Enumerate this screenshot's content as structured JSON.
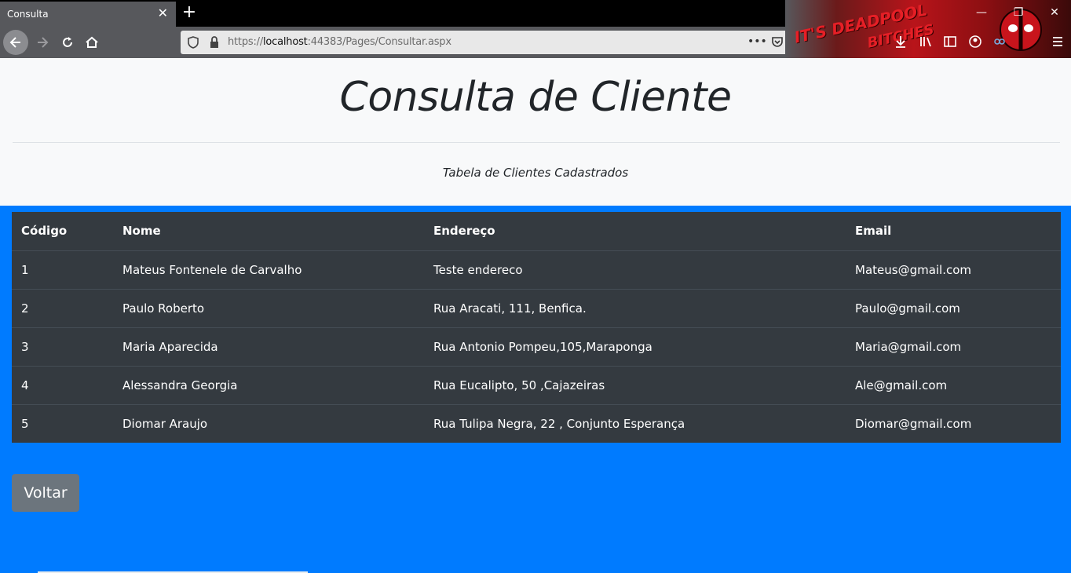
{
  "browser": {
    "tab_title": "Consulta",
    "tab_close": "✕",
    "new_tab": "+",
    "url_prefix": "https://",
    "url_host": "localhost",
    "url_rest": ":44383/Pages/Consultar.aspx",
    "url_menu": "•••",
    "theme_text_1": "IT'S DEADPOOL",
    "theme_text_2": "BITCHES",
    "win_minimize": "—",
    "win_restore": "❐",
    "win_close": "✕"
  },
  "page": {
    "title": "Consulta de Cliente",
    "subtitle": "Tabela de Clientes Cadastrados"
  },
  "table": {
    "headers": [
      "Código",
      "Nome",
      "Endereço",
      "Email"
    ],
    "rows": [
      [
        "1",
        "Mateus Fontenele de Carvalho",
        "Teste endereco",
        "Mateus@gmail.com"
      ],
      [
        "2",
        "Paulo Roberto",
        "Rua Aracati, 111, Benfica.",
        "Paulo@gmail.com"
      ],
      [
        "3",
        "Maria Aparecida",
        "Rua Antonio Pompeu,105,Maraponga",
        "Maria@gmail.com"
      ],
      [
        "4",
        "Alessandra Georgia",
        "Rua Eucalipto, 50 ,Cajazeiras",
        "Ale@gmail.com"
      ],
      [
        "5",
        "Diomar Araujo",
        "Rua Tulipa Negra, 22 , Conjunto Esperança",
        "Diomar@gmail.com"
      ]
    ]
  },
  "actions": {
    "back_label": "Voltar"
  },
  "colors": {
    "page_bg": "#007bff",
    "jumbotron_bg": "#f8f9fa",
    "table_bg": "#343a40",
    "button_bg": "#6c757d"
  }
}
